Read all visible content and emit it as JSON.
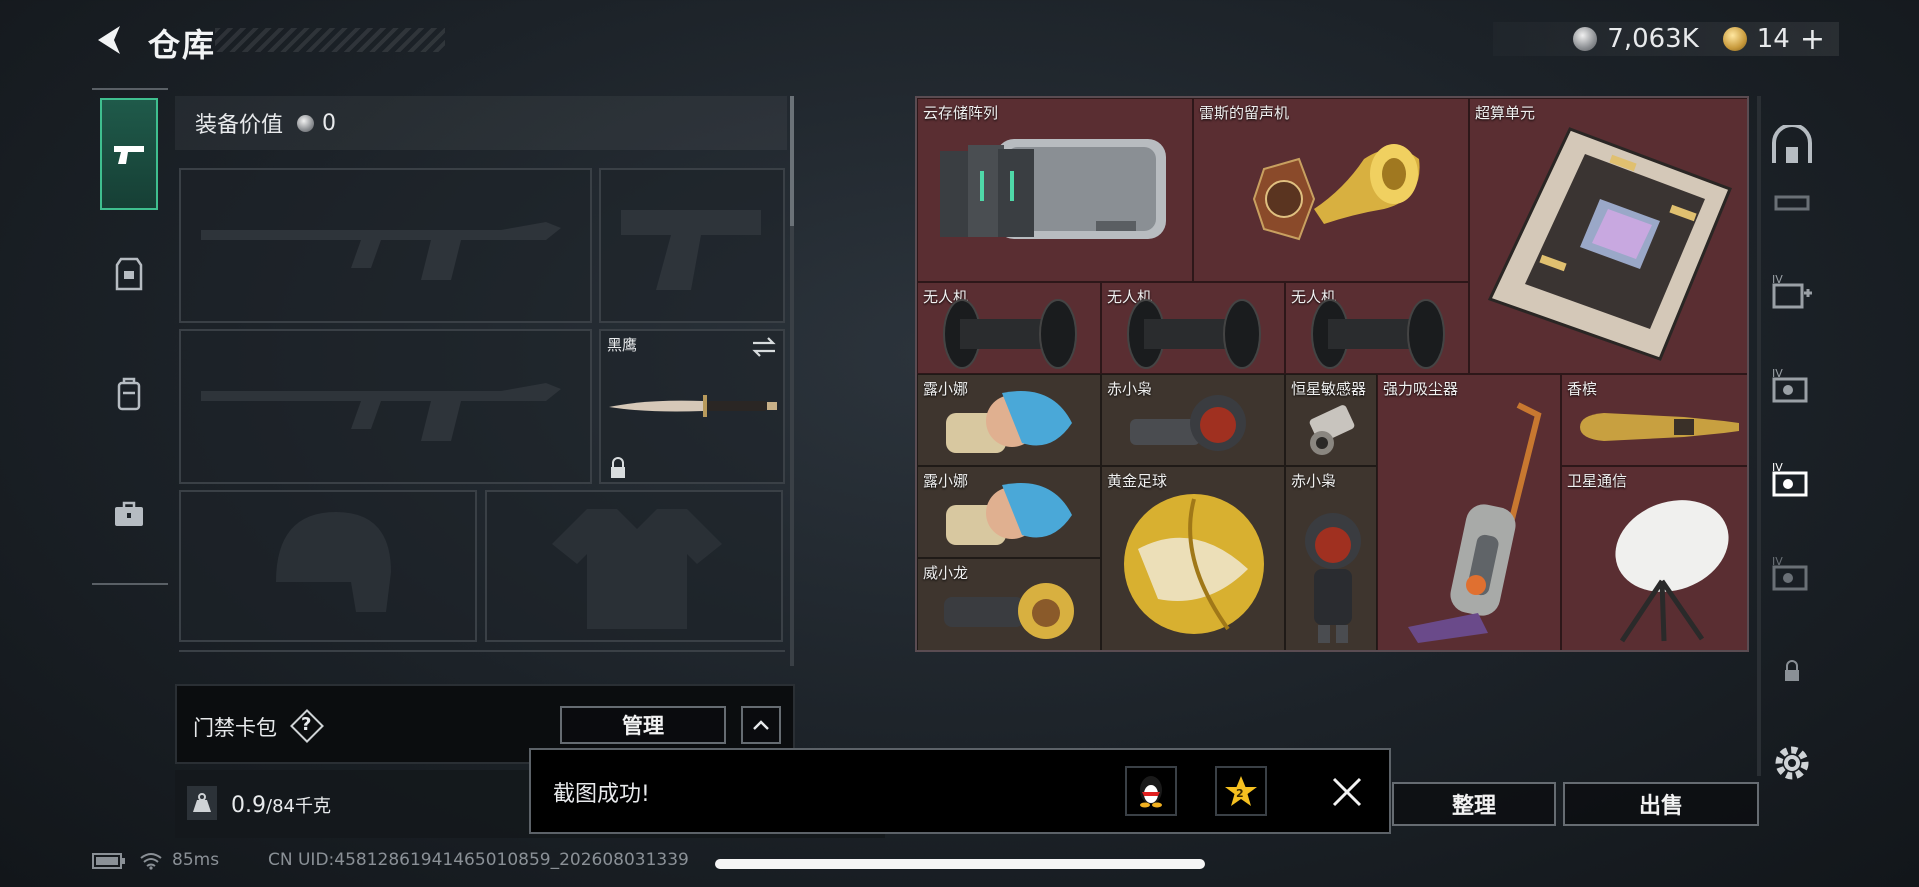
{
  "header": {
    "title": "仓库"
  },
  "currency": {
    "silver": "7,063K",
    "gold": "14",
    "gold_plus": "+"
  },
  "equipment": {
    "value_label": "装备价值",
    "value": "0",
    "melee_slot": {
      "name": "黑鹰"
    }
  },
  "card_pack": {
    "label": "门禁卡包",
    "help": "?",
    "manage_label": "管理"
  },
  "weight": {
    "current": "0.9",
    "max_unit": "/84千克"
  },
  "grid_items": [
    {
      "name": "云存储阵列"
    },
    {
      "name": "雷斯的留声机"
    },
    {
      "name": "超算单元"
    },
    {
      "name": "无人机"
    },
    {
      "name": "无人机"
    },
    {
      "name": "无人机"
    },
    {
      "name": "露小娜"
    },
    {
      "name": "赤小枭"
    },
    {
      "name": "恒星敏感器"
    },
    {
      "name": "强力吸尘器"
    },
    {
      "name": "香槟"
    },
    {
      "name": "露小娜"
    },
    {
      "name": "黄金足球"
    },
    {
      "name": "赤小枭"
    },
    {
      "name": "卫星通信"
    },
    {
      "name": "威小龙"
    }
  ],
  "buttons": {
    "organize": "整理",
    "sell": "出售"
  },
  "toast": {
    "message": "截图成功!"
  },
  "status": {
    "ping": "85ms",
    "uid": "CN UID:4581286194146501085​9_202608031339"
  },
  "colors": {
    "accent_green": "#3fbf8f",
    "cell_red": "#5a2e32",
    "cell_brown": "#3e352e"
  }
}
